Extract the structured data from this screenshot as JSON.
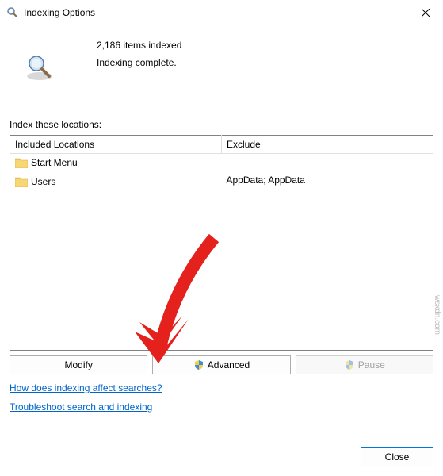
{
  "titlebar": {
    "title": "Indexing Options"
  },
  "status": {
    "count_text": "2,186 items indexed",
    "status_text": "Indexing complete."
  },
  "locations_label": "Index these locations:",
  "table": {
    "headers": {
      "included": "Included Locations",
      "exclude": "Exclude"
    },
    "rows": [
      {
        "included": "Start Menu",
        "exclude": ""
      },
      {
        "included": "Users",
        "exclude": "AppData; AppData"
      }
    ]
  },
  "buttons": {
    "modify": "Modify",
    "advanced": "Advanced",
    "pause": "Pause",
    "close": "Close"
  },
  "links": {
    "help": "How does indexing affect searches?",
    "troubleshoot": "Troubleshoot search and indexing"
  },
  "watermark": "wsxdn.com"
}
